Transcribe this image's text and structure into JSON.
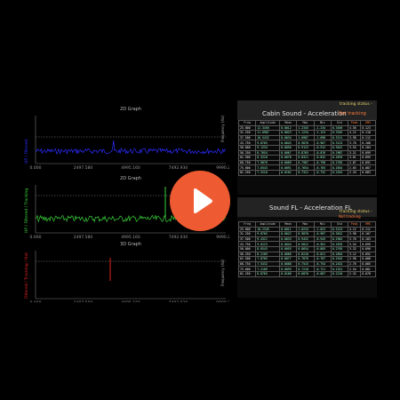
{
  "graphs": [
    {
      "title": "2D Graph",
      "ylabel": "HP / Filtered",
      "x_ticks": [
        "0.000",
        "2497.580",
        "4995.160",
        "7492.930",
        "9990.294"
      ]
    },
    {
      "title": "2D Graph",
      "ylabel": "HP / Filtered / Tracking",
      "x_ticks": [
        "0.000",
        "2497.580",
        "4995.160",
        "7492.930",
        "9990.294"
      ]
    },
    {
      "title": "3D Graph",
      "ylabel": "Filtered / Tracking / Not",
      "x_ticks": [
        "0.000",
        "2497.580",
        "4995.160",
        "7492.930",
        "9990.294"
      ]
    }
  ],
  "panels": [
    {
      "title": "Cabin Sound - Acceleration",
      "status_label": "tracking status -",
      "status_value": "Not tracking",
      "side_label": "Frequency (Hz)",
      "headers": [
        "Freq",
        "Amplitude",
        "Mean",
        "Max",
        "Min",
        "Std",
        "Peak",
        "RMS"
      ],
      "rows": [
        [
          "25.000",
          "12.3456",
          "0.0012",
          "1.2345",
          "-1.234",
          "0.3456",
          "4.56",
          "0.123"
        ],
        [
          "31.250",
          "11.0987",
          "0.0023",
          "1.1234",
          "-1.123",
          "0.3345",
          "4.12",
          "0.118"
        ],
        [
          "37.500",
          "10.5432",
          "0.0034",
          "1.0987",
          "-1.098",
          "0.3211",
          "3.98",
          "0.112"
        ],
        [
          "43.750",
          "9.8765",
          "0.0045",
          "0.9876",
          "-0.987",
          "0.3123",
          "3.76",
          "0.108"
        ],
        [
          "50.000",
          "9.1234",
          "0.0056",
          "0.9123",
          "-0.912",
          "0.3012",
          "3.54",
          "0.104"
        ],
        [
          "56.250",
          "8.7654",
          "0.0067",
          "0.8765",
          "-0.876",
          "0.2987",
          "3.21",
          "0.099"
        ],
        [
          "62.500",
          "8.3210",
          "0.0078",
          "0.8321",
          "-0.832",
          "0.2876",
          "3.01",
          "0.095"
        ],
        [
          "68.750",
          "7.9876",
          "0.0089",
          "0.7987",
          "-0.798",
          "0.2765",
          "2.87",
          "0.091"
        ],
        [
          "75.000",
          "7.6543",
          "0.0091",
          "0.7654",
          "-0.765",
          "0.2654",
          "2.65",
          "0.087"
        ],
        [
          "81.250",
          "7.3210",
          "0.0102",
          "0.7321",
          "-0.732",
          "0.2543",
          "2.43",
          "0.083"
        ]
      ]
    },
    {
      "title": "Sound FL - Acceleration FL",
      "status_label": "tracking status -",
      "status_value": "Not tracking",
      "side_label": "Frequency (Hz)",
      "headers": [
        "Freq",
        "Amplitude",
        "Mean",
        "Max",
        "Min",
        "Std",
        "Peak",
        "RMS"
      ],
      "rows": [
        [
          "25.000",
          "10.2345",
          "0.0011",
          "1.0234",
          "-1.023",
          "0.3123",
          "4.12",
          "0.111"
        ],
        [
          "31.250",
          "9.8765",
          "0.0022",
          "0.9876",
          "-0.987",
          "0.3012",
          "3.98",
          "0.107"
        ],
        [
          "37.500",
          "9.4321",
          "0.0033",
          "0.9432",
          "-0.943",
          "0.2901",
          "3.76",
          "0.103"
        ],
        [
          "43.750",
          "9.0123",
          "0.0044",
          "0.9012",
          "-0.901",
          "0.2876",
          "3.54",
          "0.099"
        ],
        [
          "50.000",
          "8.6543",
          "0.0055",
          "0.8654",
          "-0.865",
          "0.2765",
          "3.32",
          "0.096"
        ],
        [
          "56.250",
          "8.2109",
          "0.0066",
          "0.8210",
          "-0.821",
          "0.2654",
          "3.12",
          "0.092"
        ],
        [
          "62.500",
          "7.8765",
          "0.0077",
          "0.7876",
          "-0.787",
          "0.2543",
          "2.98",
          "0.088"
        ],
        [
          "68.750",
          "7.5432",
          "0.0088",
          "0.7543",
          "-0.754",
          "0.2432",
          "2.76",
          "0.085"
        ],
        [
          "75.000",
          "7.2109",
          "0.0099",
          "0.7210",
          "-0.721",
          "0.2321",
          "2.54",
          "0.081"
        ],
        [
          "81.250",
          "6.8765",
          "0.0100",
          "0.6876",
          "-0.687",
          "0.2210",
          "2.32",
          "0.078"
        ]
      ]
    }
  ],
  "play_button": {
    "icon": "play-icon"
  },
  "colors": {
    "blue": "#2b2bff",
    "green": "#39d23a",
    "red": "#e02020",
    "accent": "#ee5b32",
    "status": "#ff7a3a",
    "status_label": "#e8d36a"
  }
}
